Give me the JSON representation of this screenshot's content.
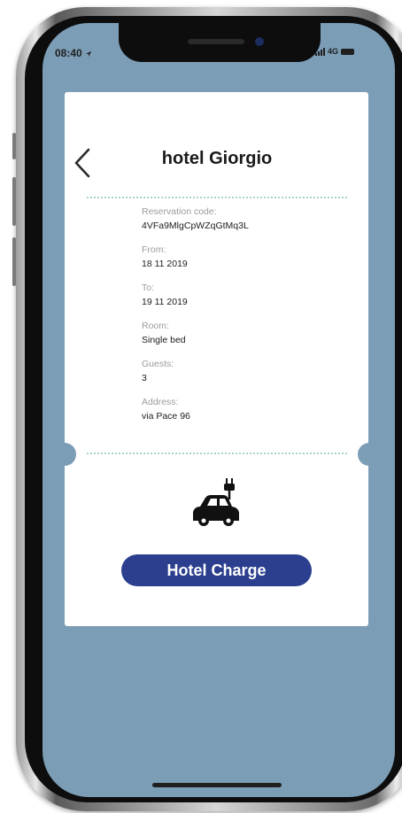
{
  "status_bar": {
    "time": "08:40",
    "network": "4G"
  },
  "header": {
    "back_icon": "chevron-left-icon",
    "title": "hotel Giorgio"
  },
  "reservation": {
    "code_label": "Reservation code:",
    "code_value": "4VFa9MlgCpWZqGtMq3L",
    "from_label": "From:",
    "from_value": "18 11 2019",
    "to_label": "To:",
    "to_value": "19 11 2019",
    "room_label": "Room:",
    "room_value": "Single bed",
    "guests_label": "Guests:",
    "guests_value": "3",
    "address_label": "Address:",
    "address_value": "via Pace 96"
  },
  "action": {
    "icon": "electric-car-icon",
    "button_label": "Hotel Charge"
  },
  "colors": {
    "background": "#7c9db6",
    "button": "#2b3f8e",
    "dotted_divider": "#a9d2cb",
    "label_text": "#9b9b9b"
  }
}
